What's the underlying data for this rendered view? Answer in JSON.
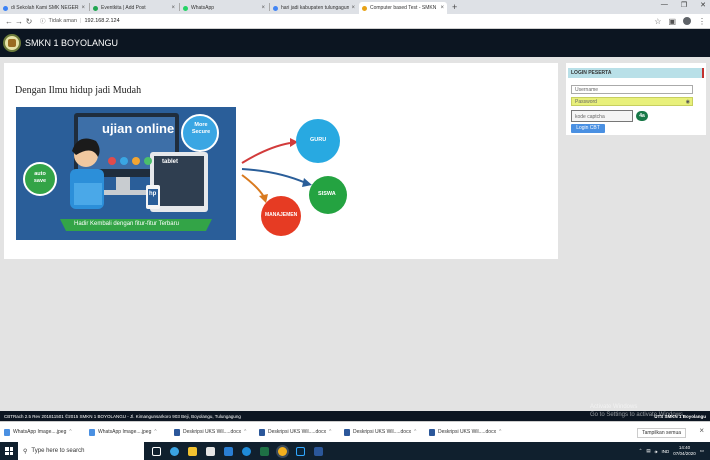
{
  "browser": {
    "tabs": [
      {
        "title": "di Sekolah Kami SMK NEGERI 1 B",
        "color": "#3b82f6",
        "active": false
      },
      {
        "title": "Eventkita | Add Post",
        "color": "#22a652",
        "active": false
      },
      {
        "title": "WhatsApp",
        "color": "#25d366",
        "active": false
      },
      {
        "title": "hari jadi kabupaten tulungagung",
        "color": "#4285f4",
        "active": false
      },
      {
        "title": "Computer based Test - SMKN 1 B",
        "color": "#e8a317",
        "active": true
      }
    ],
    "address": {
      "security": "Tidak aman",
      "url": "192.168.2.124"
    }
  },
  "app": {
    "title": "SMKN 1 BOYOLANGU"
  },
  "main": {
    "slogan": "Dengan Ilmu hidup jadi Mudah",
    "banner": {
      "headline": "ujian online",
      "bubble_secure": "More Secure",
      "bubble_auto": "auto save",
      "tablet_label": "tablet",
      "hp_label": "hp",
      "ribbon": "Hadir Kembali dengan fitur-fitur Terbaru"
    },
    "diagram": {
      "guru": "GURU",
      "siswa": "SISWA",
      "manajemen": "MANAJEMEN"
    }
  },
  "login": {
    "heading": "LOGIN PESERTA",
    "username_placeholder": "Username",
    "password_placeholder": "Password",
    "captcha_placeholder": "kode captcha",
    "captcha_code": "4a",
    "button_label": "Login CBT"
  },
  "footer": {
    "left": "CBTRach 2.5 Rev 201811501 ©2015 SMKN 1 BOYOLANGU - Jl. Kimangunsarkoro 903 Beji, Boyolangu, Tulungagung",
    "right": "UTS SMKN 1 Boyolangu",
    "watermark_line1": "Activate Windows",
    "watermark_line2": "Go to Settings to activate Windows."
  },
  "downloads": {
    "items": [
      {
        "name": "WhatsApp Image....jpeg",
        "color": "#4a90e2"
      },
      {
        "name": "WhatsApp Image....jpeg",
        "color": "#4a90e2"
      },
      {
        "name": "Deskripsi UKS Wil.....docx",
        "color": "#2b579a"
      },
      {
        "name": "Deskripsi UKS Wil.....docx",
        "color": "#2b579a"
      },
      {
        "name": "Deskripsi UKS Wil.....docx",
        "color": "#2b579a"
      },
      {
        "name": "Deskripsi UKS Wil.....docx",
        "color": "#2b579a"
      }
    ],
    "show_all": "Tampilkan semua"
  },
  "taskbar": {
    "search_placeholder": "Type here to search",
    "language": "IND",
    "time": "14:40",
    "date": "07/04/2020"
  }
}
